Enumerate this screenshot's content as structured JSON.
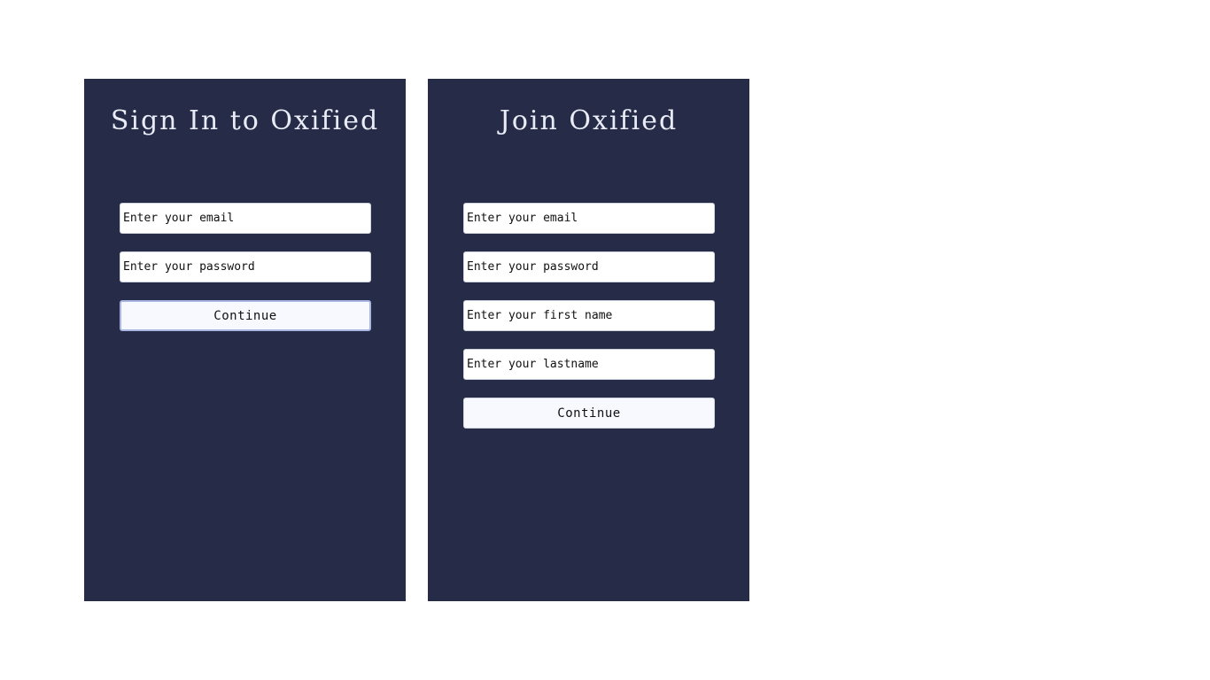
{
  "signin": {
    "title": "Sign In to Oxified",
    "email_placeholder": "Enter your email",
    "password_placeholder": "Enter your password",
    "continue_label": "Continue"
  },
  "join": {
    "title": "Join Oxified",
    "email_placeholder": "Enter your email",
    "password_placeholder": "Enter your password",
    "firstname_placeholder": "Enter your first name",
    "lastname_placeholder": "Enter your lastname",
    "continue_label": "Continue"
  },
  "colors": {
    "panel_background": "#262b47",
    "title_text": "#e9ecf7",
    "button_background": "#f7f9fe",
    "focus_ring": "#a9b6e3"
  }
}
